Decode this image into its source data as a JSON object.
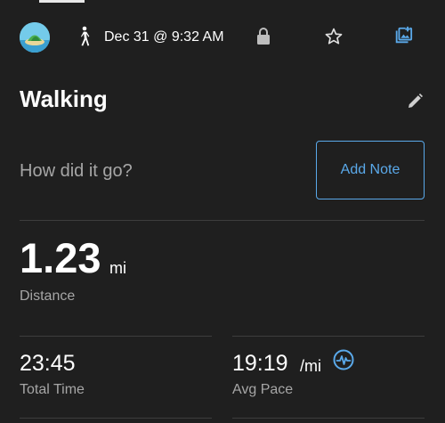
{
  "header": {
    "date_time": "Dec 31 @ 9:32 AM",
    "activity_icon": "walking-icon",
    "privacy_icon": "lock-icon",
    "favorite_icon": "star-icon",
    "photo_icon": "add-photo-icon"
  },
  "activity": {
    "title": "Walking",
    "note_prompt": "How did it go?",
    "add_note_label": "Add Note"
  },
  "stats": {
    "distance": {
      "value": "1.23",
      "unit": "mi",
      "label": "Distance"
    },
    "total_time": {
      "value": "23:45",
      "label": "Total Time"
    },
    "avg_pace": {
      "value": "19:19",
      "unit": "/mi",
      "label": "Avg Pace"
    }
  },
  "colors": {
    "background": "#1f1f1f",
    "accent": "#5aa9ea",
    "secondary_text": "#a6a6a6",
    "divider": "#3d3d3d"
  }
}
